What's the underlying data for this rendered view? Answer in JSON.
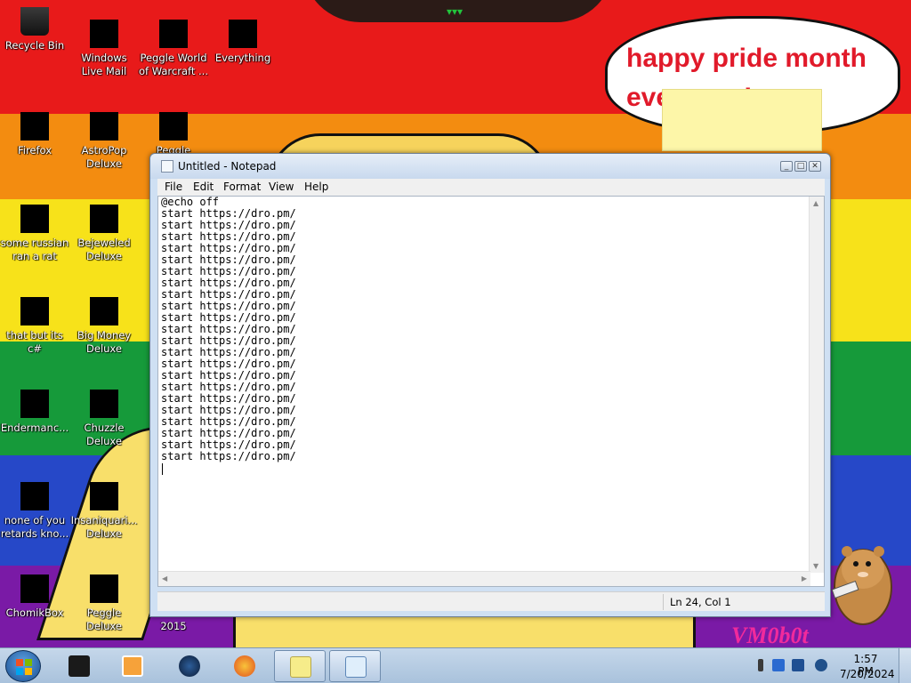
{
  "desktop": {
    "speech_text": "happy pride month everyone!",
    "watermark": "VM0b0t",
    "icons": [
      {
        "label": "Recycle Bin"
      },
      {
        "label": "Windows Live Mail"
      },
      {
        "label": "Peggle World of Warcraft ..."
      },
      {
        "label": "Everything"
      },
      {
        "label": "Firefox"
      },
      {
        "label": "AstroPop Deluxe"
      },
      {
        "label": "Peggle Nights"
      },
      {
        "label": "some russian ran a rat"
      },
      {
        "label": "Bejeweled Deluxe"
      },
      {
        "label": "that but its c#"
      },
      {
        "label": "Big Money Deluxe"
      },
      {
        "label": "Endermanc..."
      },
      {
        "label": "Chuzzle Deluxe"
      },
      {
        "label": "none of you retards kno..."
      },
      {
        "label": "Insaniquari... Deluxe"
      },
      {
        "label": "ChomikBox"
      },
      {
        "label": "Peggle Deluxe"
      },
      {
        "label": "2015"
      }
    ]
  },
  "notepad": {
    "title": "Untitled - Notepad",
    "menu": [
      "File",
      "Edit",
      "Format",
      "View",
      "Help"
    ],
    "content": "@echo off\nstart https://dro.pm/\nstart https://dro.pm/\nstart https://dro.pm/\nstart https://dro.pm/\nstart https://dro.pm/\nstart https://dro.pm/\nstart https://dro.pm/\nstart https://dro.pm/\nstart https://dro.pm/\nstart https://dro.pm/\nstart https://dro.pm/\nstart https://dro.pm/\nstart https://dro.pm/\nstart https://dro.pm/\nstart https://dro.pm/\nstart https://dro.pm/\nstart https://dro.pm/\nstart https://dro.pm/\nstart https://dro.pm/\nstart https://dro.pm/\nstart https://dro.pm/\nstart https://dro.pm/",
    "status": "Ln 24, Col 1"
  },
  "taskbar": {
    "time": "1:57 PM",
    "date": "7/20/2024",
    "items": [
      {
        "icon": "black-cube-icon"
      },
      {
        "icon": "media-player-icon"
      },
      {
        "icon": "globe-icon"
      },
      {
        "icon": "firefox-icon"
      },
      {
        "icon": "sticky-notes-icon"
      },
      {
        "icon": "notepad-icon"
      }
    ]
  }
}
